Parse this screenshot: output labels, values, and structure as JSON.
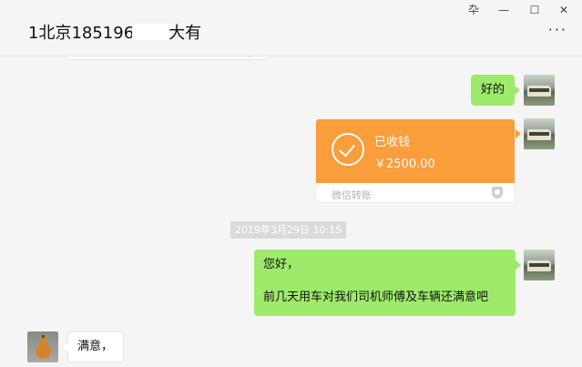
{
  "header": {
    "title_prefix": "1北京185196",
    "title_suffix": "大有",
    "more_icon": "more-dots-icon"
  },
  "window_controls": {
    "pin_icon": "pin-icon",
    "pin_glyph": "卆",
    "minimize_icon": "minimize-icon",
    "minimize_glyph": "—",
    "maximize_icon": "maximize-icon",
    "maximize_glyph": "☐",
    "close_icon": "close-icon",
    "close_glyph": "✕"
  },
  "messages": [
    {
      "sender": "me",
      "type": "text",
      "text": "好的"
    },
    {
      "sender": "me",
      "type": "transfer",
      "status": "已收钱",
      "amount": "￥2500.00",
      "footer": "微信转账",
      "icon": "check-circle-icon",
      "color": "#fa9d3b"
    },
    {
      "type": "timestamp",
      "text": "2019年3月29日 10:15"
    },
    {
      "sender": "me",
      "type": "text",
      "line1": "您好，",
      "line2": "前几天用车对我们司机师傅及车辆还满意吧"
    },
    {
      "sender": "other",
      "type": "text",
      "text": "满意，"
    }
  ],
  "colors": {
    "background": "#f5f5f5",
    "my_bubble": "#9eea6a",
    "transfer": "#fa9d3b",
    "timestamp_bg": "#dadada"
  }
}
